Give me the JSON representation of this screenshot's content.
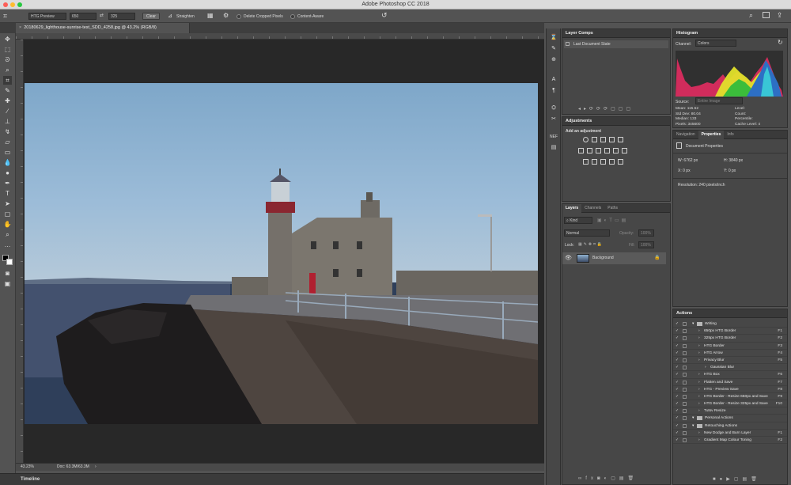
{
  "window": {
    "title": "Adobe Photoshop CC 2018"
  },
  "options": {
    "preset": "HTG Preview",
    "width_value": "650",
    "height_value": "325",
    "clear_label": "Clear",
    "straighten_label": "Straighten",
    "delete_cropped_label": "Delete Cropped Pixels",
    "content_aware_label": "Content-Aware"
  },
  "document": {
    "tab_title": "20180629_lighthouse-sunrise-test_SDD_4258.jpg @ 43.2% (RGB/8)",
    "zoom": "43.23%",
    "doc_size": "Doc: 63.3M/63.3M"
  },
  "timeline": {
    "label": "Timeline"
  },
  "layer_comps": {
    "title": "Layer Comps",
    "item": "Last Document State"
  },
  "adjustments": {
    "title": "Adjustments",
    "subtitle": "Add an adjustment"
  },
  "layers": {
    "tabs": [
      "Layers",
      "Channels",
      "Paths"
    ],
    "kind": "Kind",
    "blend_mode": "Normal",
    "opacity_label": "Opacity:",
    "opacity_value": "100%",
    "lock_label": "Lock:",
    "fill_label": "Fill:",
    "fill_value": "100%",
    "layer_name": "Background"
  },
  "histogram": {
    "title": "Histogram",
    "channel_label": "Channel:",
    "channel_value": "Colors",
    "source_label": "Source:",
    "source_value": "Entire Image",
    "stats_left": [
      {
        "label": "Mean:",
        "value": "115.52"
      },
      {
        "label": "Std Dev:",
        "value": "80.04"
      },
      {
        "label": "Median:",
        "value": "133"
      },
      {
        "label": "Pixels:",
        "value": "345600"
      }
    ],
    "stats_right": [
      {
        "label": "Level:",
        "value": ""
      },
      {
        "label": "Count:",
        "value": ""
      },
      {
        "label": "Percentile:",
        "value": ""
      },
      {
        "label": "Cache Level:",
        "value": "4"
      }
    ]
  },
  "properties": {
    "tabs": [
      "Navigation",
      "Properties",
      "Info"
    ],
    "doc_props": "Document Properties",
    "w": "W: 6762 px",
    "h": "H: 3840 px",
    "x": "X: 0 px",
    "y": "Y: 0 px",
    "resolution": "Resolution: 240 pixels/inch"
  },
  "actions": {
    "title": "Actions",
    "items": [
      {
        "name": "Writing",
        "indent": 0,
        "folder": true,
        "key": ""
      },
      {
        "name": "650px HTG Border",
        "indent": 1,
        "folder": false,
        "key": "F1"
      },
      {
        "name": "325px HTG Border",
        "indent": 1,
        "folder": false,
        "key": "F2"
      },
      {
        "name": "HTG Border",
        "indent": 1,
        "folder": false,
        "key": "F3"
      },
      {
        "name": "HTG Arrow",
        "indent": 1,
        "folder": false,
        "key": "F4"
      },
      {
        "name": "Privacy Blur",
        "indent": 1,
        "folder": false,
        "key": "F5"
      },
      {
        "name": "Gaussian Blur",
        "indent": 2,
        "folder": false,
        "key": ""
      },
      {
        "name": "HTG Box",
        "indent": 1,
        "folder": false,
        "key": "F6"
      },
      {
        "name": "Flatten and Save",
        "indent": 1,
        "folder": false,
        "key": "F7"
      },
      {
        "name": "HTG - Preview Save",
        "indent": 1,
        "folder": false,
        "key": "F8"
      },
      {
        "name": "HTG Border - Resize 650px and Save",
        "indent": 1,
        "folder": false,
        "key": "F9"
      },
      {
        "name": "HTG Border - Resize 325px and Save",
        "indent": 1,
        "folder": false,
        "key": "F10"
      },
      {
        "name": "Tutsv Resize",
        "indent": 1,
        "folder": false,
        "key": ""
      },
      {
        "name": "Personal Actions",
        "indent": 0,
        "folder": true,
        "key": ""
      },
      {
        "name": "Retouching Actions",
        "indent": 0,
        "folder": true,
        "key": ""
      },
      {
        "name": "New Dodge and Burn Layer",
        "indent": 1,
        "folder": false,
        "key": "F1"
      },
      {
        "name": "Gradient Map Colour Toning",
        "indent": 1,
        "folder": false,
        "key": "F2"
      }
    ]
  },
  "colors": {
    "ui_bg": "#535353",
    "panel_bg": "#474747",
    "accent": "#2d6fc4"
  }
}
